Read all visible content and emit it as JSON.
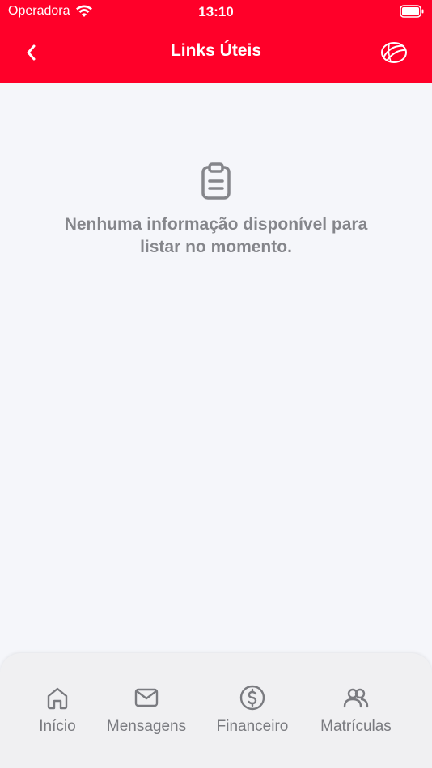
{
  "status_bar": {
    "carrier": "Operadora",
    "time": "13:10"
  },
  "header": {
    "title": "Links Úteis",
    "back_icon": "chevron-left-icon",
    "logo_icon": "ball-logo-icon",
    "background": "#ff0029"
  },
  "empty_state": {
    "icon": "clipboard-icon",
    "message": "Nenhuma informação disponível para listar no momento."
  },
  "tabbar": {
    "items": [
      {
        "label": "Início",
        "icon": "home-icon"
      },
      {
        "label": "Mensagens",
        "icon": "mail-icon"
      },
      {
        "label": "Financeiro",
        "icon": "dollar-circle-icon"
      },
      {
        "label": "Matrículas",
        "icon": "users-icon"
      }
    ]
  }
}
